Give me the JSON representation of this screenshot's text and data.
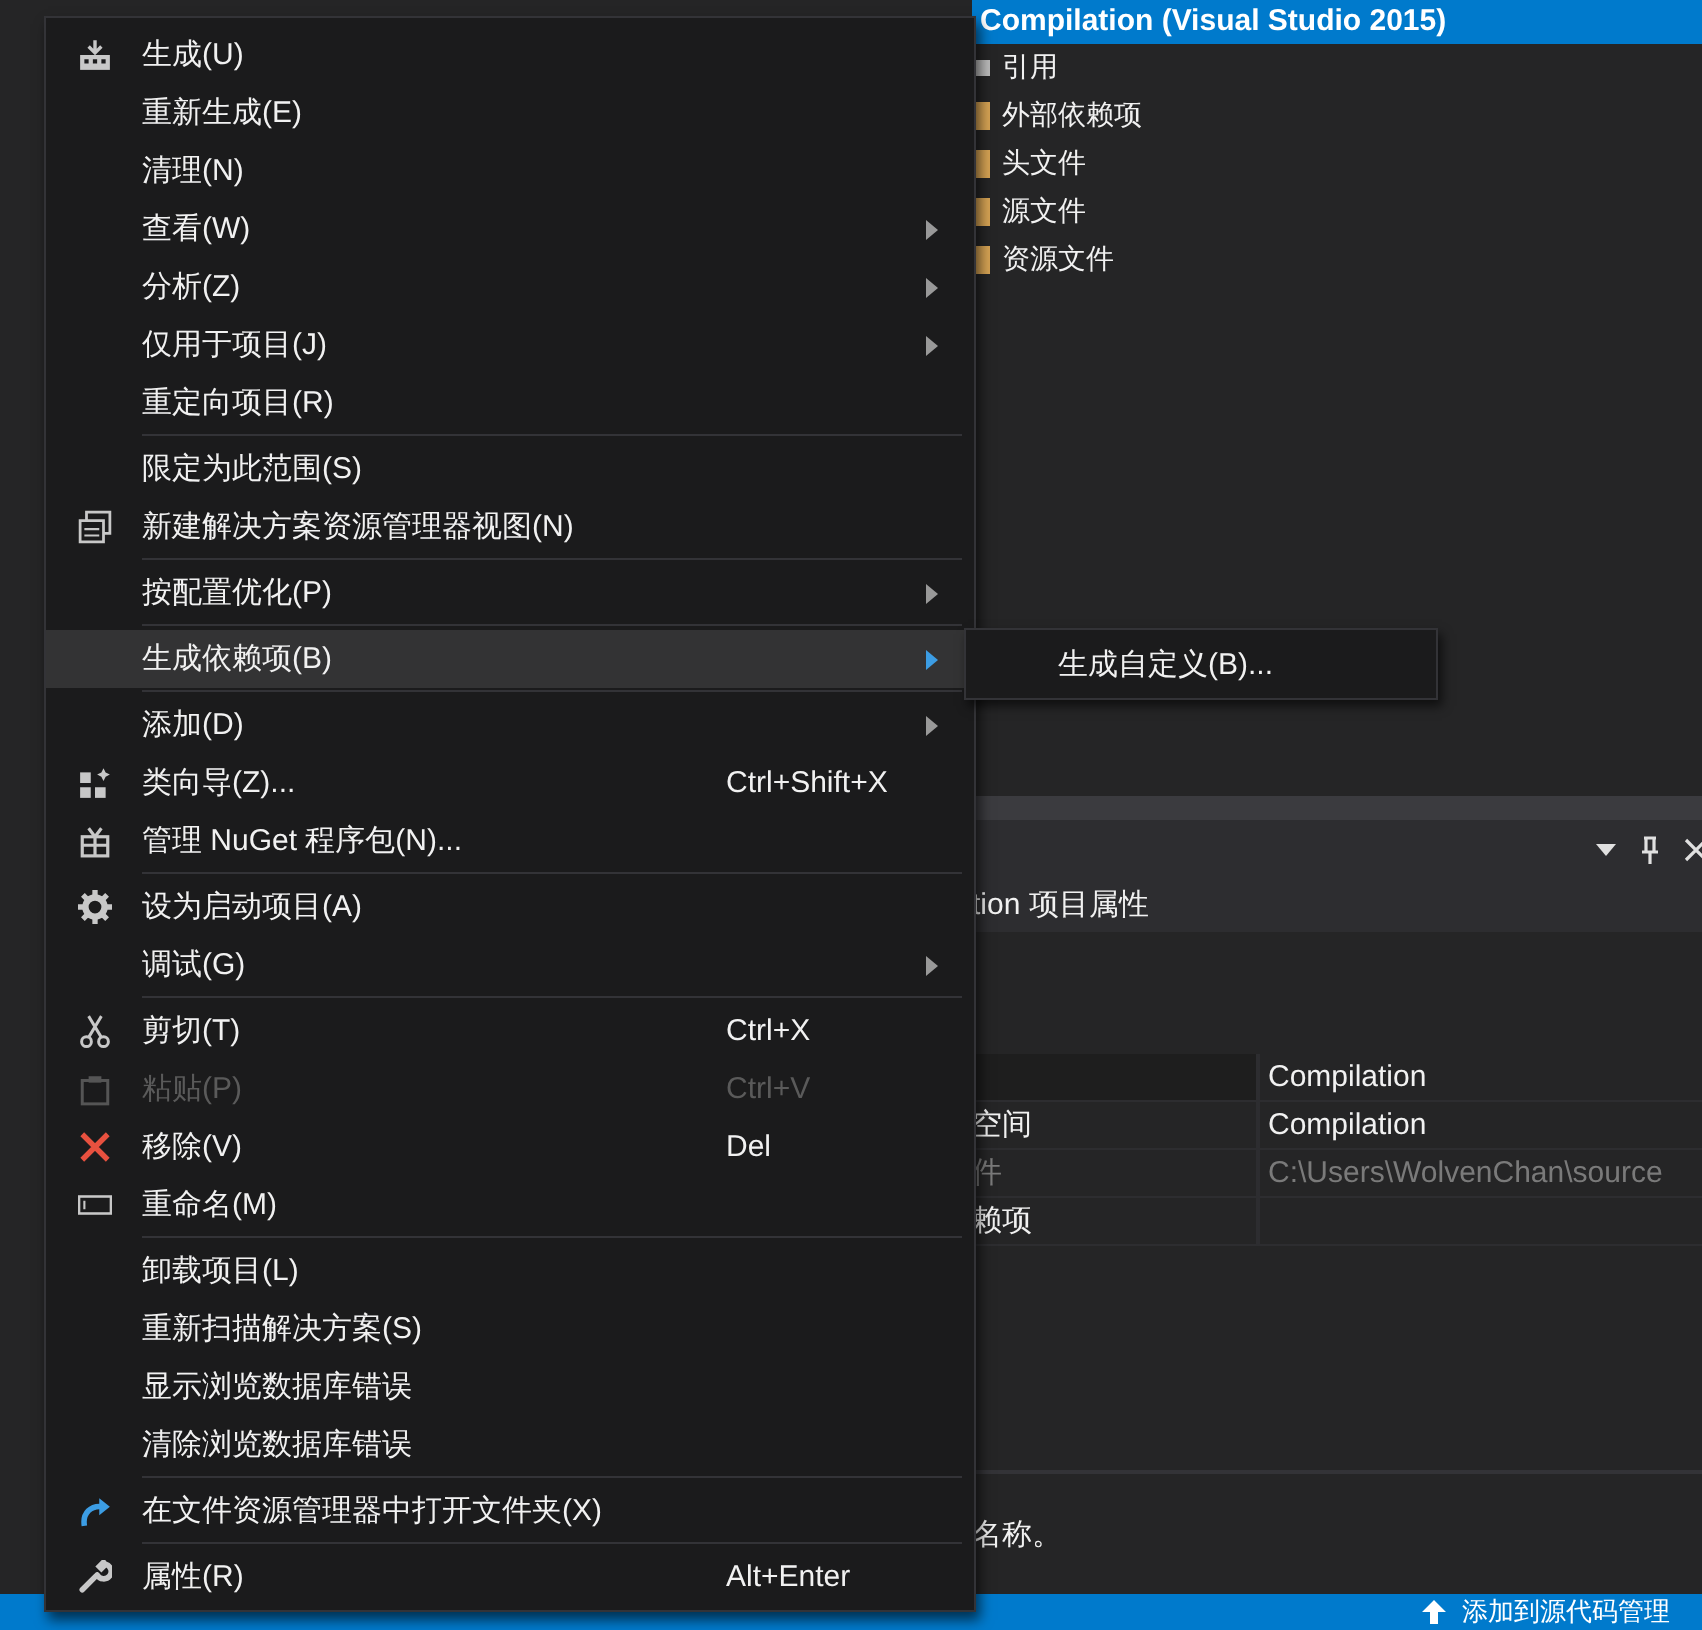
{
  "solution_explorer": {
    "project": "Compilation (Visual Studio 2015)",
    "items": [
      {
        "label": "引用"
      },
      {
        "label": "外部依赖项"
      },
      {
        "label": "头文件"
      },
      {
        "label": "源文件"
      },
      {
        "label": "资源文件"
      }
    ]
  },
  "properties": {
    "title": "tion 项目属性",
    "rows": [
      {
        "value": "Compilation",
        "disabled": false
      },
      {
        "name": "空间",
        "value": "Compilation",
        "disabled": false
      },
      {
        "name": "件",
        "value": "C:\\Users\\WolvenChan\\source",
        "disabled": true
      },
      {
        "name": "赖项",
        "disabled": false
      }
    ],
    "description": "名称。"
  },
  "context_menu": [
    {
      "kind": "item",
      "label": "生成(U)",
      "submenu": false,
      "disabled": false,
      "selected": false
    },
    {
      "kind": "item",
      "label": "重新生成(E)",
      "submenu": false,
      "disabled": false,
      "selected": false
    },
    {
      "kind": "item",
      "label": "清理(N)",
      "submenu": false,
      "disabled": false,
      "selected": false
    },
    {
      "kind": "item",
      "label": "查看(W)",
      "submenu": true,
      "disabled": false,
      "selected": false
    },
    {
      "kind": "item",
      "label": "分析(Z)",
      "submenu": true,
      "disabled": false,
      "selected": false
    },
    {
      "kind": "item",
      "label": "仅用于项目(J)",
      "submenu": true,
      "disabled": false,
      "selected": false
    },
    {
      "kind": "item",
      "label": "重定向项目(R)",
      "submenu": false,
      "disabled": false,
      "selected": false
    },
    {
      "kind": "separator"
    },
    {
      "kind": "item",
      "label": "限定为此范围(S)",
      "submenu": false,
      "disabled": false,
      "selected": false
    },
    {
      "kind": "item",
      "label": "新建解决方案资源管理器视图(N)",
      "submenu": false,
      "disabled": false,
      "selected": false
    },
    {
      "kind": "separator"
    },
    {
      "kind": "item",
      "label": "按配置优化(P)",
      "submenu": true,
      "disabled": false,
      "selected": false
    },
    {
      "kind": "separator"
    },
    {
      "kind": "item",
      "label": "生成依赖项(B)",
      "submenu": true,
      "disabled": false,
      "selected": true
    },
    {
      "kind": "separator"
    },
    {
      "kind": "item",
      "label": "添加(D)",
      "submenu": true,
      "disabled": false,
      "selected": false
    },
    {
      "kind": "item",
      "label": "类向导(Z)...",
      "shortcut": "Ctrl+Shift+X",
      "submenu": false,
      "disabled": false,
      "selected": false
    },
    {
      "kind": "item",
      "label": "管理 NuGet 程序包(N)...",
      "submenu": false,
      "disabled": false,
      "selected": false
    },
    {
      "kind": "separator"
    },
    {
      "kind": "item",
      "label": "设为启动项目(A)",
      "submenu": false,
      "disabled": false,
      "selected": false
    },
    {
      "kind": "item",
      "label": "调试(G)",
      "submenu": true,
      "disabled": false,
      "selected": false
    },
    {
      "kind": "separator"
    },
    {
      "kind": "item",
      "label": "剪切(T)",
      "shortcut": "Ctrl+X",
      "submenu": false,
      "disabled": false,
      "selected": false
    },
    {
      "kind": "item",
      "label": "粘贴(P)",
      "shortcut": "Ctrl+V",
      "submenu": false,
      "disabled": true,
      "selected": false
    },
    {
      "kind": "item",
      "label": "移除(V)",
      "shortcut": "Del",
      "submenu": false,
      "disabled": false,
      "selected": false
    },
    {
      "kind": "item",
      "label": "重命名(M)",
      "submenu": false,
      "disabled": false,
      "selected": false
    },
    {
      "kind": "separator"
    },
    {
      "kind": "item",
      "label": "卸载项目(L)",
      "submenu": false,
      "disabled": false,
      "selected": false
    },
    {
      "kind": "item",
      "label": "重新扫描解决方案(S)",
      "submenu": false,
      "disabled": false,
      "selected": false
    },
    {
      "kind": "item",
      "label": "显示浏览数据库错误",
      "submenu": false,
      "disabled": false,
      "selected": false
    },
    {
      "kind": "item",
      "label": "清除浏览数据库错误",
      "submenu": false,
      "disabled": false,
      "selected": false
    },
    {
      "kind": "separator"
    },
    {
      "kind": "item",
      "label": "在文件资源管理器中打开文件夹(X)",
      "submenu": false,
      "disabled": false,
      "selected": false
    },
    {
      "kind": "separator"
    },
    {
      "kind": "item",
      "label": "属性(R)",
      "shortcut": "Alt+Enter",
      "submenu": false,
      "disabled": false,
      "selected": false
    }
  ],
  "submenu": [
    {
      "label": "生成自定义(B)..."
    }
  ],
  "status_bar": {
    "text": "添加到源代码管理"
  }
}
